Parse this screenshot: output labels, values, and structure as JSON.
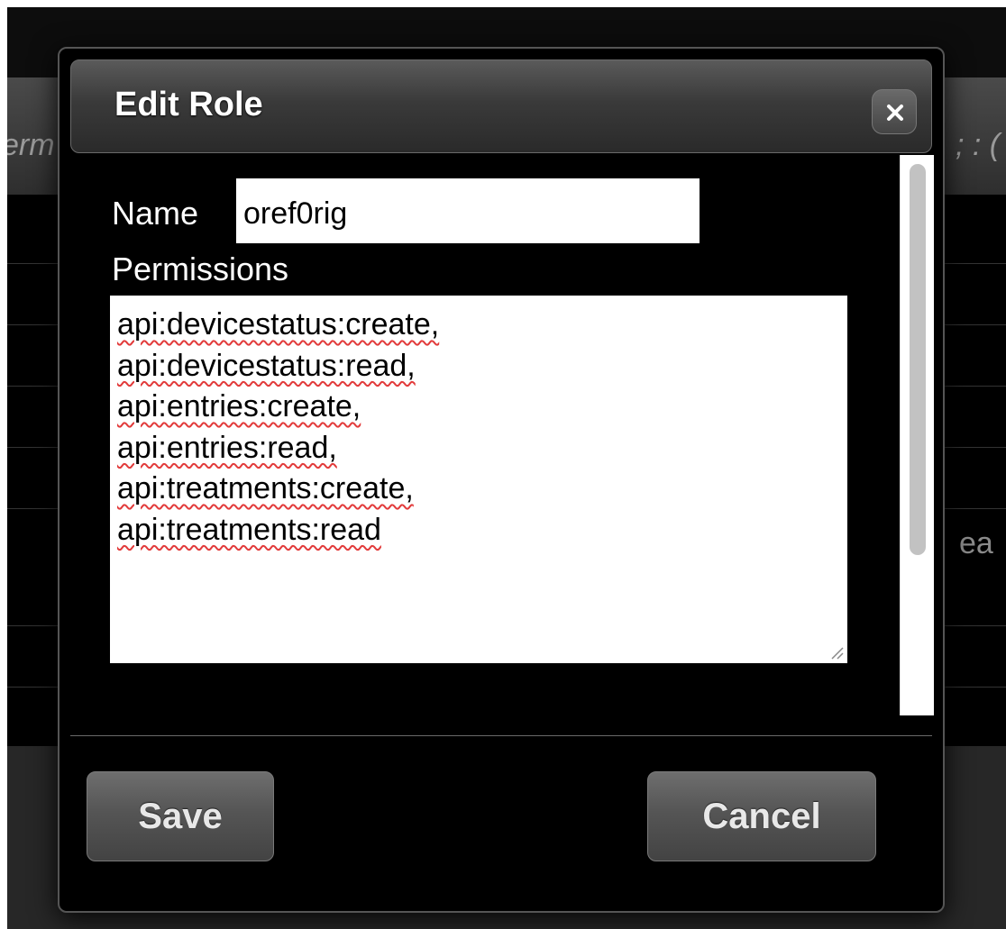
{
  "background": {
    "header_left_fragment": "erm",
    "header_right_fragment": "; : (",
    "row_right_fragment": "ea"
  },
  "dialog": {
    "title": "Edit Role",
    "close_label": "×",
    "name_label": "Name",
    "name_value": "oref0rig",
    "permissions_label": "Permissions",
    "permissions": [
      "api:devicestatus:create,",
      "api:devicestatus:read,",
      "api:entries:create,",
      "api:entries:read,",
      "api:treatments:create,",
      "api:treatments:read"
    ],
    "save_label": "Save",
    "cancel_label": "Cancel"
  }
}
